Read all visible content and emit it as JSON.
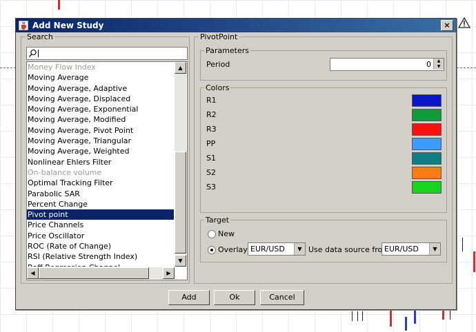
{
  "dialog": {
    "title": "Add New Study",
    "close_glyph": "×"
  },
  "search": {
    "title": "Search",
    "value": "",
    "items": [
      {
        "label": "Money Flow Index",
        "state": "disabled"
      },
      {
        "label": "Moving Average",
        "state": "normal"
      },
      {
        "label": "Moving Average, Adaptive",
        "state": "normal"
      },
      {
        "label": "Moving Average, Displaced",
        "state": "normal"
      },
      {
        "label": "Moving Average, Exponential",
        "state": "normal"
      },
      {
        "label": "Moving Average, Modified",
        "state": "normal"
      },
      {
        "label": "Moving Average, Pivot Point",
        "state": "normal"
      },
      {
        "label": "Moving Average, Triangular",
        "state": "normal"
      },
      {
        "label": "Moving Average, Weighted",
        "state": "normal"
      },
      {
        "label": "Nonlinear Ehlers Filter",
        "state": "normal"
      },
      {
        "label": "On-balance volume",
        "state": "disabled"
      },
      {
        "label": "Optimal Tracking Filter",
        "state": "normal"
      },
      {
        "label": "Parabolic SAR",
        "state": "normal"
      },
      {
        "label": "Percent Change",
        "state": "normal"
      },
      {
        "label": "Pivot point",
        "state": "selected"
      },
      {
        "label": "Price Channels",
        "state": "normal"
      },
      {
        "label": "Price Oscillator",
        "state": "normal"
      },
      {
        "label": "ROC (Rate of Change)",
        "state": "normal"
      },
      {
        "label": "RSI (Relative Strength Index)",
        "state": "normal"
      },
      {
        "label": "Raff Regression Channel",
        "state": "normal"
      }
    ]
  },
  "pivot": {
    "title": "PivotPoint",
    "parameters": {
      "title": "Parameters",
      "period_label": "Period",
      "period_value": "0"
    },
    "colors": {
      "title": "Colors",
      "items": [
        {
          "label": "R1",
          "color": "#0a14c8"
        },
        {
          "label": "R2",
          "color": "#119a3a"
        },
        {
          "label": "R3",
          "color": "#ff1010"
        },
        {
          "label": "PP",
          "color": "#3d9bff"
        },
        {
          "label": "S1",
          "color": "#0f7f86"
        },
        {
          "label": "S2",
          "color": "#ff7a10"
        },
        {
          "label": "S3",
          "color": "#19d31e"
        }
      ]
    },
    "target": {
      "title": "Target",
      "new_label": "New",
      "overlay_label": "Overlay",
      "overlay_value": "EUR/USD",
      "source_label": "Use data source from",
      "source_value": "EUR/USD",
      "selected": "overlay"
    }
  },
  "buttons": {
    "add": "Add",
    "ok": "Ok",
    "cancel": "Cancel"
  }
}
